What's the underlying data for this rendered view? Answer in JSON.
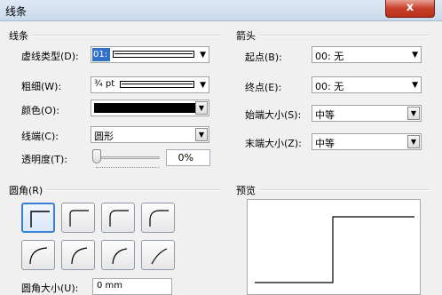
{
  "window": {
    "title": "线条",
    "close_glyph": "x"
  },
  "line_group": {
    "title": "线条",
    "dash_type": {
      "label": "虚线类型(D):",
      "value": "01:"
    },
    "weight": {
      "label": "粗细(W):",
      "value": "¾ pt"
    },
    "color": {
      "label": "颜色(O):",
      "value_color": "#000000"
    },
    "cap": {
      "label": "线端(C):",
      "value": "圆形"
    },
    "transparency": {
      "label": "透明度(T):",
      "value": "0%",
      "level": 0
    }
  },
  "arrow_group": {
    "title": "箭头",
    "start": {
      "label": "起点(B):",
      "value": "00: 无"
    },
    "end": {
      "label": "终点(E):",
      "value": "00: 无"
    },
    "start_size": {
      "label": "始端大小(S):",
      "value": "中等"
    },
    "end_size": {
      "label": "末端大小(Z):",
      "value": "中等"
    }
  },
  "corner_group": {
    "title": "圆角(R)",
    "size_label": "圆角大小(U):",
    "size_value": "0 mm",
    "selected_index": 0
  },
  "preview_group": {
    "title": "预览"
  },
  "colors": {
    "selection": "#3070c8",
    "close": "#c7402b",
    "accent": "#3c7fcf"
  }
}
